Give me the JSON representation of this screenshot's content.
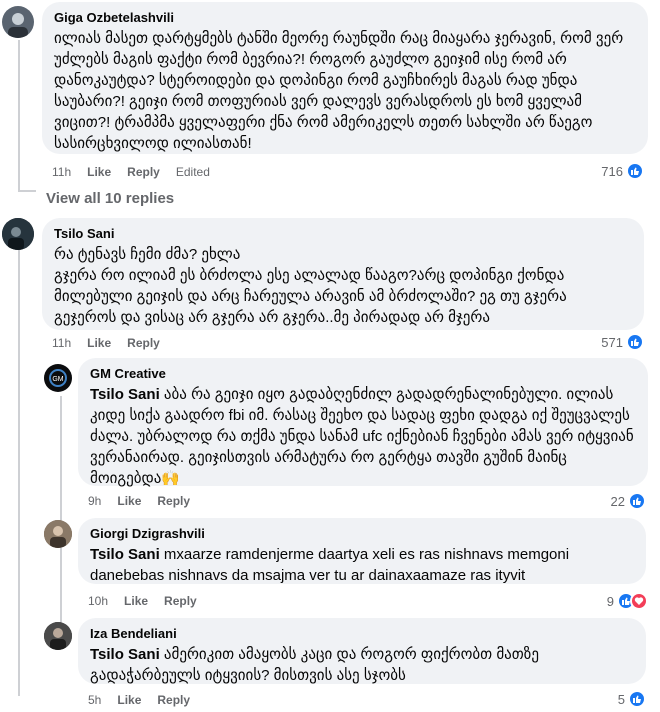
{
  "comments": [
    {
      "author": "Giga Ozbetelashvili",
      "text": "ილიას მასეთ დარტყმებს ტანში მეორე რაუნდში რაც მიაყარა ჯერავინ, რომ ვერ უძლებს მაგის ფაქტი რომ ბევრია?! როგორ გაუძლო გეიჯიმ ისე რომ არ დანოკაუტდა? სტეროიდები და დოპინგი რომ გაუჩხირეს მაგას რად უნდა საუბარი?! გეიჯი რომ თოფურიას ვერ დალევს ვერასდროს ეს ხომ ყველამ ვიცით?! ტრამპმა ყველაფერი ქნა რომ ამერიკელს თეთრ სახლში არ წაეგო სასირცხვილოდ ილიასთან!",
      "time": "11h",
      "like": "Like",
      "reply": "Reply",
      "edited": "Edited",
      "reactions": "716"
    },
    {
      "author": "Tsilo Sani",
      "text": "რა ტენავს ჩემი ძმა? ეხლა\nგჯერა რო ილიამ ეს ბრძოლა ესე ალალად წააგო?არც დოპინგი ქონდა მილებული გეიჯის და არც ჩარეულა არავინ ამ ბრძოლაში? ეგ თუ გჯერა გეჯეროს და ვისაც არ გჯერა არ გჯერა..მე პირადად არ მჯერა",
      "time": "11h",
      "like": "Like",
      "reply": "Reply",
      "reactions": "571"
    }
  ],
  "view_all": "View all 10 replies",
  "replies": [
    {
      "author": "GM Creative",
      "mention": "Tsilo Sani",
      "text": "აბა რა გეიჯი იყო გადაბღენძილ გადადრენალინებული. ილიას კიდე სიქა გაადრო fbi იმ. რასაც შეეხო და სადაც ფეხი დადგა იქ შეუცვალეს ძალა. უბრალოდ რა თქმა უნდა სანამ ufc იქნებიან ჩვენები ამას ვერ იტყვიან ვერანაირად. გეიჯისთვის არმატურა რო გერტყა თავში გუშინ მაინც მოიგებდა🙌",
      "time": "9h",
      "like": "Like",
      "reply": "Reply",
      "reactions": "22"
    },
    {
      "author": "Giorgi Dzigrashvili",
      "mention": "Tsilo Sani",
      "text": "mxaarze ramdenjerme daartya xeli es ras nishnavs memgoni danebebas nishnavs da msajma ver tu ar dainaxaamaze ras ityvit",
      "time": "10h",
      "like": "Like",
      "reply": "Reply",
      "reactions": "9"
    },
    {
      "author": "Iza Bendeliani",
      "mention": "Tsilo Sani",
      "text": "ამერიკით ამაყობს კაცი და როგორ ფიქრობთ მათზე გადაჭარბეულს იტყვიის? მისთვის ასე სჯობს",
      "time": "5h",
      "like": "Like",
      "reply": "Reply",
      "reactions": "5"
    }
  ],
  "icons": {
    "like": "like-reaction-icon",
    "love": "love-reaction-icon"
  },
  "colors": {
    "bubble": "#f0f2f5",
    "like_blue": "#1877f2",
    "love_red": "#f33e58",
    "meta_gray": "#65676b"
  }
}
